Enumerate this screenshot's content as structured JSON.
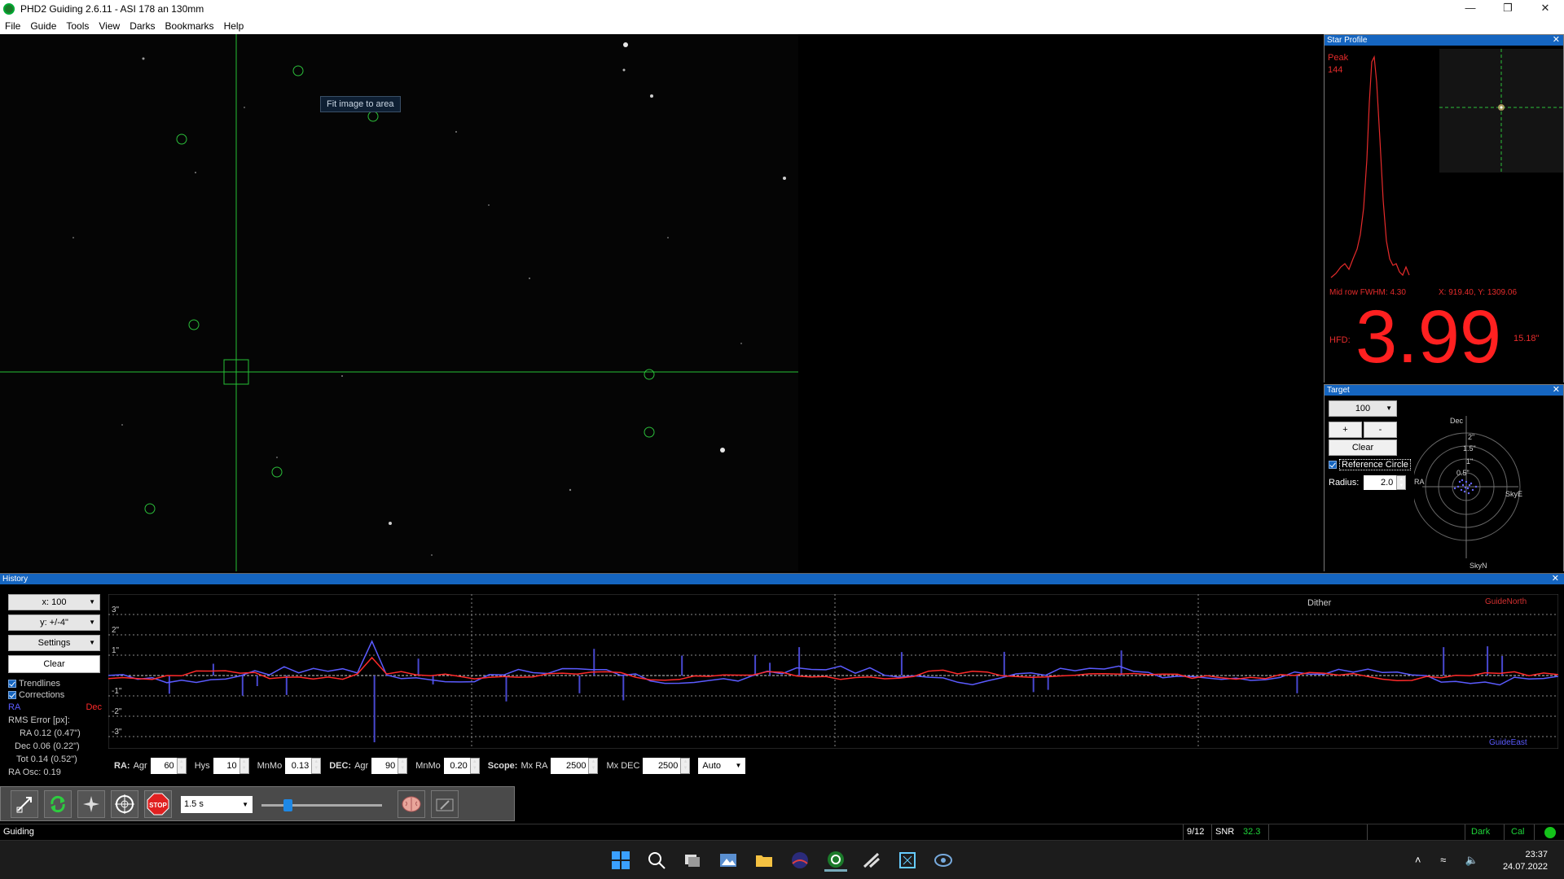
{
  "window": {
    "title": "PHD2 Guiding 2.6.11 - ASI 178 an 130mm",
    "minimize": "—",
    "restore": "❐",
    "close": "✕"
  },
  "menu": [
    "File",
    "Guide",
    "Tools",
    "View",
    "Darks",
    "Bookmarks",
    "Help"
  ],
  "main_image": {
    "tooltip": "Fit image to area"
  },
  "star_profile": {
    "title": "Star Profile",
    "close": "✕",
    "peak_label": "Peak",
    "peak_value": "144",
    "fwhm": "Mid row FWHM: 4.30",
    "xy": "X: 919.40, Y: 1309.06",
    "hfd_label": "HFD:",
    "hfd_value": "3.99",
    "hfd_arcsec": "15.18\"",
    "profile_color": "#e62b2b"
  },
  "target": {
    "title": "Target",
    "close": "✕",
    "zoom_value": "100",
    "plus_label": "+",
    "minus_label": "-",
    "clear_label": "Clear",
    "reference_circle_label": "Reference Circle",
    "reference_circle_checked": true,
    "radius_label": "Radius:",
    "radius_value": "2.0",
    "axis_dec": "Dec",
    "axis_ra": "RA",
    "axis_skye": "SkyE",
    "axis_skyn": "SkyN",
    "ring_labels": [
      "2\"",
      "1.5\"",
      "1\"",
      "0.5\""
    ]
  },
  "history": {
    "title": "History",
    "close": "✕",
    "x_scale": "x: 100",
    "y_scale": "y: +/-4\"",
    "settings_label": "Settings",
    "clear_label": "Clear",
    "trendlines_label": "Trendlines",
    "corrections_label": "Corrections",
    "legend_ra": "RA",
    "legend_dec": "Dec",
    "rms_header": "RMS Error [px]:",
    "rms_ra": "RA  0.12 (0.47\")",
    "rms_dec": "Dec  0.06 (0.22\")",
    "rms_tot": "Tot  0.14 (0.52\")",
    "ra_osc": "RA Osc: 0.19",
    "y_ticks": [
      "3\"",
      "2\"",
      "1\"",
      "-1\"",
      "-2\"",
      "-3\""
    ],
    "guide_north": "GuideNorth",
    "guide_east": "GuideEast",
    "dither_label": "Dither",
    "ra_color": "#5b5bff",
    "dec_color": "#ff2a2a",
    "controls": {
      "ra_label": "RA:",
      "ra_agr_label": "Agr",
      "ra_agr": "60",
      "hys_label": "Hys",
      "hys": "10",
      "ra_mnmo_label": "MnMo",
      "ra_mnmo": "0.13",
      "dec_label": "DEC:",
      "dec_agr_label": "Agr",
      "dec_agr": "90",
      "dec_mnmo_label": "MnMo",
      "dec_mnmo": "0.20",
      "scope_label": "Scope:",
      "mx_ra_label": "Mx RA",
      "mx_ra": "2500",
      "mx_dec_label": "Mx DEC",
      "mx_dec": "2500",
      "mode": "Auto"
    }
  },
  "toolbar": {
    "buttons": [
      "usb-icon",
      "loop-icon",
      "auto-select-star-icon",
      "guide-crosshair-icon",
      "stop-icon"
    ],
    "stop_label": "STOP",
    "exposure": "1.5 s",
    "gamma_level": 0.2,
    "brain_icon": "brain-icon",
    "tools_icon": "tools-icon"
  },
  "status": {
    "state": "Guiding",
    "frame": "9/12",
    "snr_label": "SNR",
    "snr_value": "32.3",
    "dark": "Dark",
    "cal": "Cal",
    "indicator_color": "#14c21a"
  },
  "taskbar": {
    "apps": [
      "windows-start-icon",
      "search-icon",
      "task-view-icon",
      "photos-icon",
      "file-explorer-icon",
      "stellarium-icon",
      "phd2-icon",
      "ascom-icon",
      "nina-icon",
      "sharpcap-icon"
    ],
    "time": "23:37",
    "date": "24.07.2022"
  }
}
